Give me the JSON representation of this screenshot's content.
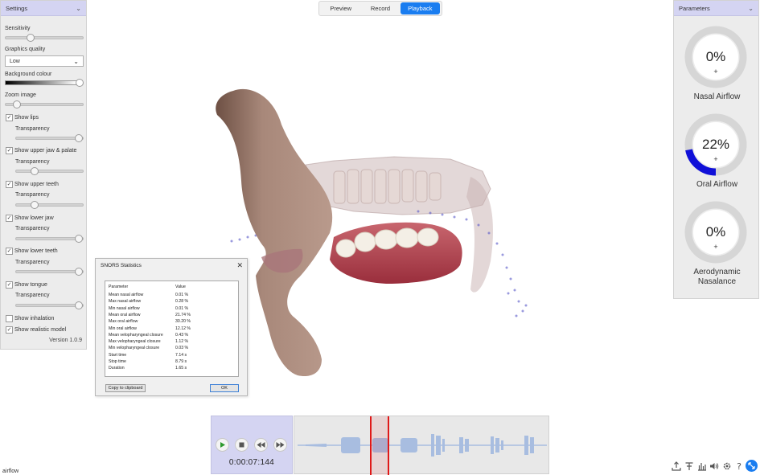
{
  "settings": {
    "title": "Settings",
    "sensitivity_label": "Sensitivity",
    "sensitivity": 0.3,
    "graphics_quality_label": "Graphics quality",
    "graphics_quality_value": "Low",
    "background_colour_label": "Background colour",
    "background_colour": 1.0,
    "zoom_label": "Zoom image",
    "zoom": 0.1,
    "transparency_label": "Transparency",
    "items": [
      {
        "label": "Show lips",
        "checked": true,
        "transparency": 1.0
      },
      {
        "label": "Show upper jaw & palate",
        "checked": true,
        "transparency": 0.25
      },
      {
        "label": "Show upper teeth",
        "checked": true,
        "transparency": 0.25
      },
      {
        "label": "Show lower jaw",
        "checked": true,
        "transparency": 1.0
      },
      {
        "label": "Show lower teeth",
        "checked": true,
        "transparency": 1.0
      },
      {
        "label": "Show tongue",
        "checked": true,
        "transparency": 1.0
      }
    ],
    "show_inhalation": {
      "label": "Show inhalation",
      "checked": false
    },
    "show_realistic_model": {
      "label": "Show realistic model",
      "checked": true
    },
    "version": "Version 1.0.9"
  },
  "tabs": [
    {
      "label": "Preview",
      "active": false
    },
    {
      "label": "Record",
      "active": false
    },
    {
      "label": "Playback",
      "active": true
    }
  ],
  "parameters": {
    "title": "Parameters",
    "gauges": [
      {
        "value": "0%",
        "fraction": 0.0,
        "plus": "+",
        "label": "Nasal Airflow"
      },
      {
        "value": "22%",
        "fraction": 0.22,
        "plus": "+",
        "label": "Oral Airflow"
      },
      {
        "value": "0%",
        "fraction": 0.0,
        "plus": "+",
        "label_line1": "Aerodynamic",
        "label_line2": "Nasalance"
      }
    ],
    "gauge_track_color": "#d6d6d6",
    "gauge_fill_color": "#1010d8"
  },
  "stats_dialog": {
    "title": "SNORS Statistics",
    "close": "✕",
    "header": {
      "param": "Parameter",
      "value": "Value"
    },
    "rows": [
      {
        "param": "Mean nasal airflow",
        "value": "0.01 %"
      },
      {
        "param": "Max nasal airflow",
        "value": "0.28 %"
      },
      {
        "param": "Min nasal airflow",
        "value": "0.01 %"
      },
      {
        "param": "Mean oral airflow",
        "value": "21.74 %"
      },
      {
        "param": "Max oral airflow",
        "value": "30.20 %"
      },
      {
        "param": "Min oral airflow",
        "value": "12.12 %"
      },
      {
        "param": "Mean velopharyngeal closure",
        "value": "0.43 %"
      },
      {
        "param": "Max velopharyngeal closure",
        "value": "1.12 %"
      },
      {
        "param": "Min velopharyngeal closure",
        "value": "0.03 %"
      },
      {
        "param": "Start time",
        "value": "7.14 s"
      },
      {
        "param": "Stop time",
        "value": "8.79 s"
      },
      {
        "param": "Duration",
        "value": "1.65 s"
      }
    ],
    "copy_button": "Copy to clipboard",
    "ok_button": "OK"
  },
  "playback": {
    "timecode": "0:00:07:144",
    "selection_color": "#e01818"
  },
  "footer": {
    "label": "airflow",
    "tools": [
      "export-icon",
      "text-icon",
      "chart-icon",
      "volume-icon",
      "settings-icon",
      "help-icon",
      "expand-icon"
    ]
  }
}
